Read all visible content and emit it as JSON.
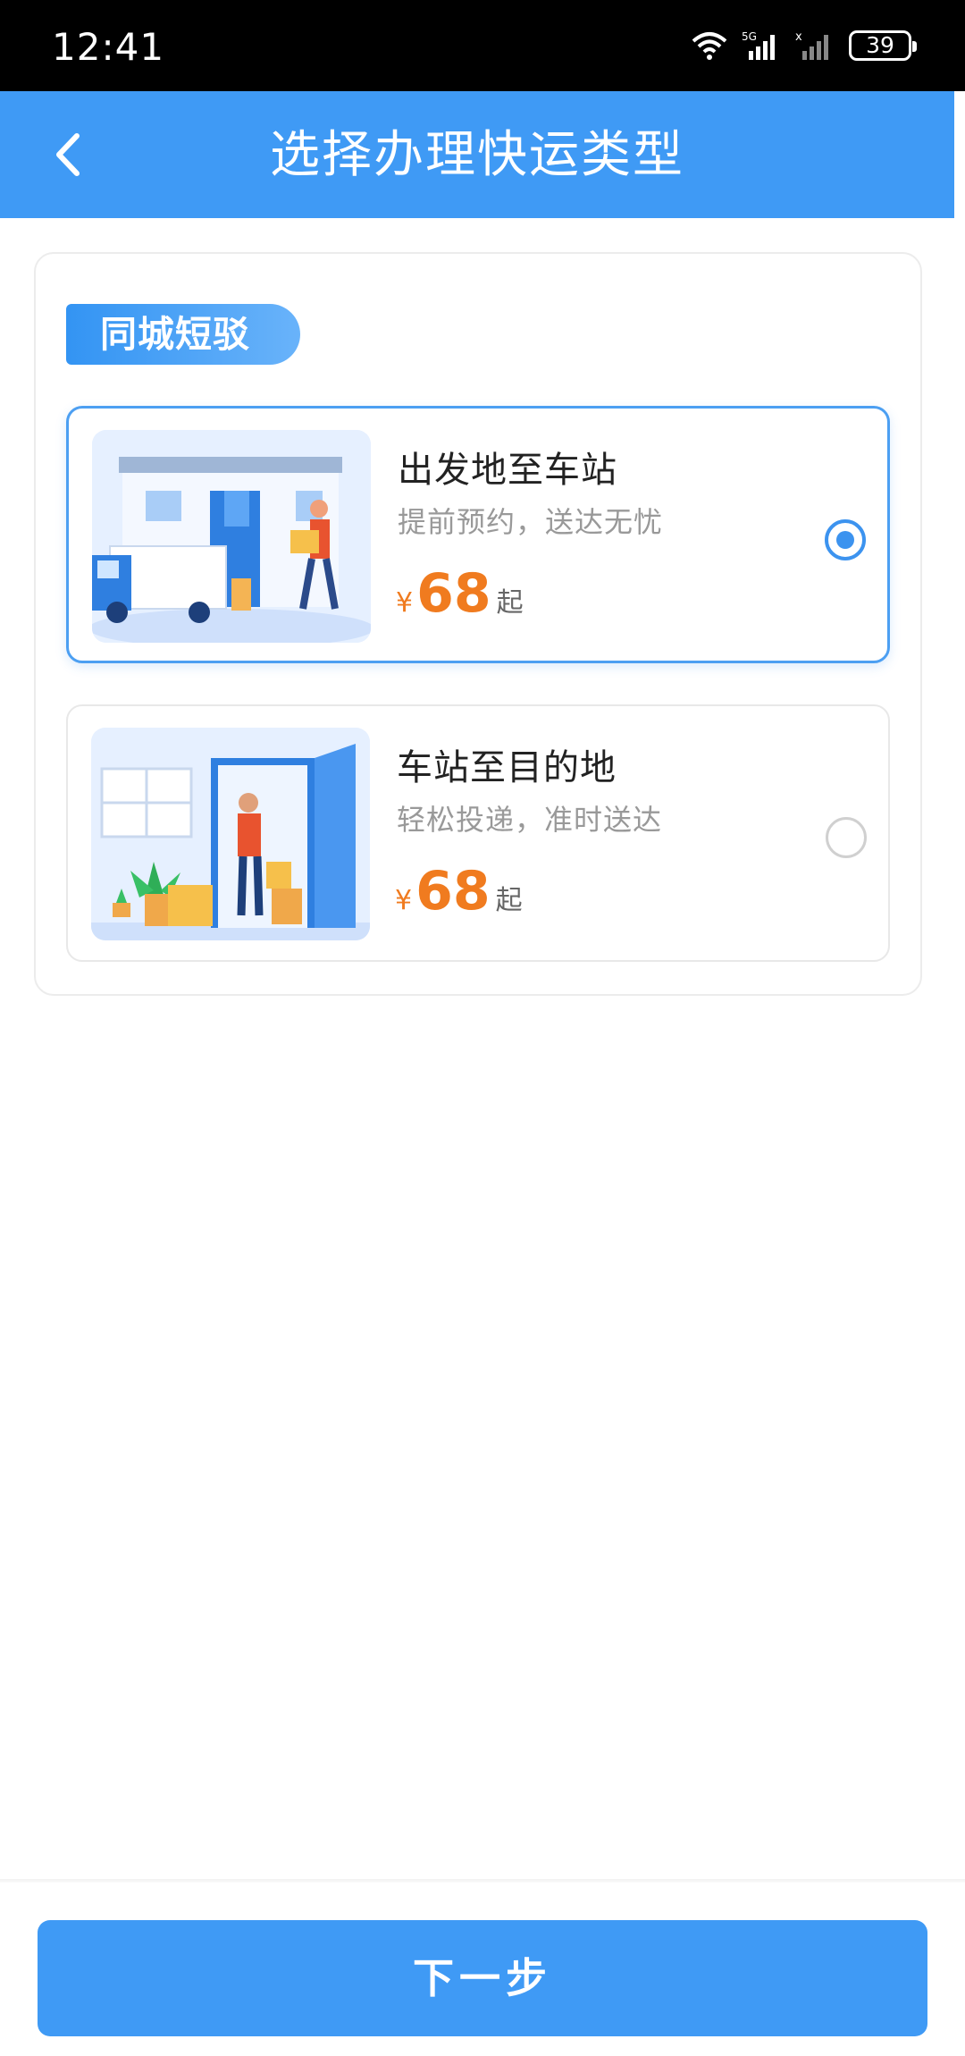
{
  "status_bar": {
    "time": "12:41",
    "network": "5G",
    "battery": "39"
  },
  "header": {
    "title": "选择办理快运类型"
  },
  "section": {
    "tag": "同城短驳"
  },
  "options": [
    {
      "title": "出发地至车站",
      "subtitle": "提前预约，送达无忧",
      "currency": "¥",
      "price": "68",
      "price_suffix": "起",
      "selected": true
    },
    {
      "title": "车站至目的地",
      "subtitle": "轻松投递，准时送达",
      "currency": "¥",
      "price": "68",
      "price_suffix": "起",
      "selected": false
    }
  ],
  "footer": {
    "next_label": "下一步"
  },
  "colors": {
    "primary": "#3f9af5",
    "price": "#f07b1f"
  },
  "icons": [
    "wifi-icon",
    "signal-icon",
    "battery-icon",
    "back-icon",
    "radio-selected-icon",
    "radio-unselected-icon"
  ]
}
